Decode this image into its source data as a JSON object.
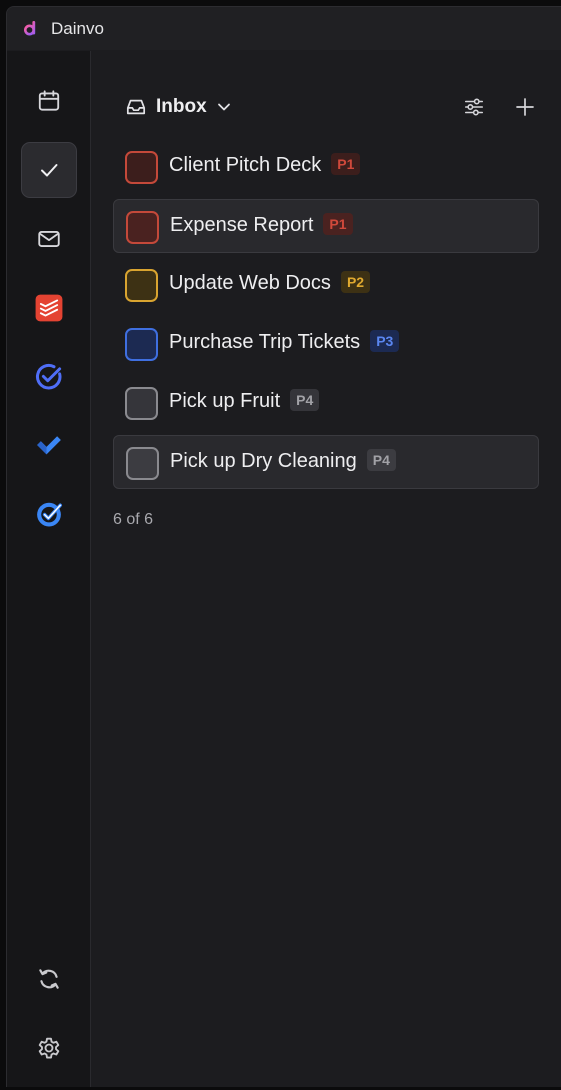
{
  "app": {
    "title": "Dainvo",
    "logo_icon": "dainvo-logo-icon"
  },
  "sidebar": {
    "items": [
      {
        "name": "calendar",
        "icon": "calendar-icon",
        "active": false
      },
      {
        "name": "tasks",
        "icon": "checkmark-icon",
        "active": true
      },
      {
        "name": "mail",
        "icon": "mail-icon",
        "active": false
      },
      {
        "name": "todoist",
        "icon": "todoist-icon",
        "color": "#e44332"
      },
      {
        "name": "tick-circle",
        "icon": "circle-check-icon",
        "color": "#4f6ef7"
      },
      {
        "name": "microsoft-todo",
        "icon": "ms-todo-check-icon",
        "color": "#3a86f5"
      },
      {
        "name": "target-check",
        "icon": "target-check-icon",
        "color": "#3a86f5"
      }
    ],
    "bottom": [
      {
        "name": "sync",
        "icon": "sync-icon"
      },
      {
        "name": "settings",
        "icon": "gear-icon"
      }
    ]
  },
  "header": {
    "title": "Inbox",
    "inbox_icon": "inbox-tray-icon",
    "dropdown_icon": "chevron-down-icon",
    "filter_icon": "sliders-icon",
    "add_icon": "plus-icon"
  },
  "tasks": [
    {
      "title": "Client Pitch Deck",
      "priority": "P1",
      "color": "#c4493a",
      "badge_bg": "#3c1e1c",
      "badge_fg": "#d0493b",
      "highlight": false
    },
    {
      "title": "Expense Report",
      "priority": "P1",
      "color": "#c4493a",
      "badge_bg": "#4a2220",
      "badge_fg": "#d0493b",
      "highlight": true
    },
    {
      "title": "Update Web Docs",
      "priority": "P2",
      "color": "#d9a430",
      "badge_bg": "#3d3114",
      "badge_fg": "#e0a92f",
      "highlight": false
    },
    {
      "title": "Purchase Trip Tickets",
      "priority": "P3",
      "color": "#3f6fe0",
      "badge_bg": "#1c2a52",
      "badge_fg": "#5a86f0",
      "highlight": false
    },
    {
      "title": "Pick up Fruit",
      "priority": "P4",
      "color": "#8a8a8f",
      "badge_bg": "#35353a",
      "badge_fg": "#a2a2a7",
      "highlight": false
    },
    {
      "title": "Pick up Dry Cleaning",
      "priority": "P4",
      "color": "#8a8a8f",
      "badge_bg": "#3c3c41",
      "badge_fg": "#a2a2a7",
      "highlight": true
    }
  ],
  "footer": {
    "count_text": "6 of 6"
  }
}
